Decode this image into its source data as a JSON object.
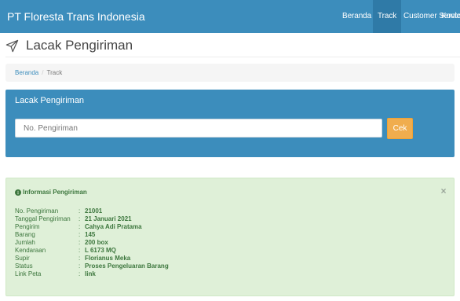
{
  "navbar": {
    "brand": "PT Floresta Trans Indonesia",
    "items": [
      {
        "label": "Beranda",
        "active": false
      },
      {
        "label": "Track",
        "active": true
      },
      {
        "label": "Customer Service",
        "active": false
      },
      {
        "label": "Kontak",
        "active": false
      }
    ]
  },
  "page": {
    "title": "Lacak Pengiriman",
    "title_icon": "paper-plane-icon"
  },
  "breadcrumb": {
    "home": "Beranda",
    "separator": "/",
    "current": "Track"
  },
  "track_panel": {
    "title": "Lacak Pengiriman",
    "input_placeholder": "No. Pengiriman",
    "input_value": "",
    "button_label": "Cek"
  },
  "info": {
    "heading": "Informasi Pengiriman",
    "heading_icon": "info-circle-icon",
    "close_label": "×",
    "colon": ":",
    "rows": [
      {
        "label": "No. Pengiriman",
        "value": "21001"
      },
      {
        "label": "Tanggal Pengiriman",
        "value": "21 Januari 2021"
      },
      {
        "label": "Pengirim",
        "value": "Cahya Adi Pratama"
      },
      {
        "label": "Barang",
        "value": "145"
      },
      {
        "label": "Jumlah",
        "value": "200 box"
      },
      {
        "label": "Kendaraan",
        "value": "L 6173 MQ"
      },
      {
        "label": "Supir",
        "value": "Florianus Meka"
      },
      {
        "label": "Status",
        "value": "Proses Pengeluaran Barang"
      },
      {
        "label": "Link Peta",
        "value": "link"
      }
    ]
  },
  "colors": {
    "primary": "#3c8dbc",
    "warning": "#f0ad4e",
    "success_bg": "#dff0d8",
    "success_text": "#3c763d"
  }
}
